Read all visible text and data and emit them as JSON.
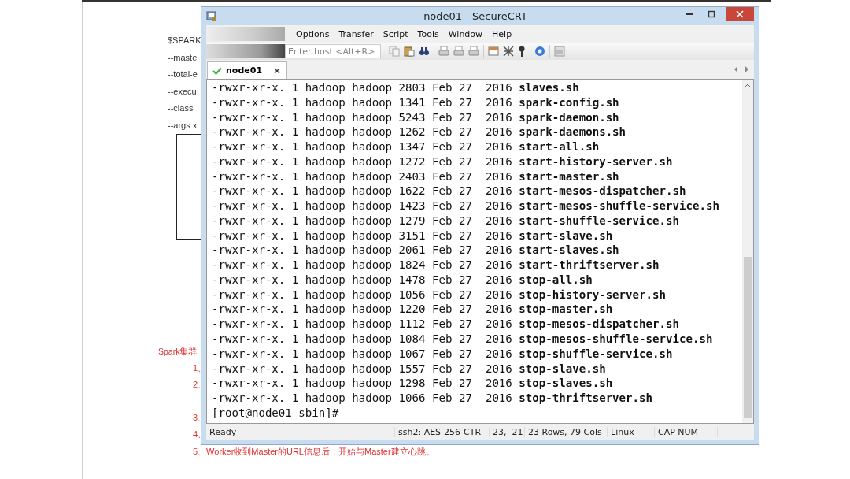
{
  "document": {
    "code_lines": [
      "$SPARK",
      "--maste",
      "--total-e",
      "--execu",
      "--class",
      "--args x"
    ],
    "heading": "Spark集群",
    "steps": [
      "1、",
      "2、",
      "3、",
      "4、",
      "5、Worker收到Master的URL信息后，开始与Master建立心跳。"
    ]
  },
  "window": {
    "title": "node01 - SecureCRT"
  },
  "menu": [
    "Options",
    "Transfer",
    "Script",
    "Tools",
    "Window",
    "Help"
  ],
  "toolbar": {
    "host_field": {
      "placeholder": "Enter host <Alt+R>"
    }
  },
  "tabs": [
    {
      "label": "node01",
      "selected": true,
      "connected": true
    }
  ],
  "terminal": {
    "rows": [
      {
        "meta": "-rwxr-xr-x. 1 hadoop hadoop 2803 Feb 27  2016",
        "name": "slaves.sh"
      },
      {
        "meta": "-rwxr-xr-x. 1 hadoop hadoop 1341 Feb 27  2016",
        "name": "spark-config.sh"
      },
      {
        "meta": "-rwxr-xr-x. 1 hadoop hadoop 5243 Feb 27  2016",
        "name": "spark-daemon.sh"
      },
      {
        "meta": "-rwxr-xr-x. 1 hadoop hadoop 1262 Feb 27  2016",
        "name": "spark-daemons.sh"
      },
      {
        "meta": "-rwxr-xr-x. 1 hadoop hadoop 1347 Feb 27  2016",
        "name": "start-all.sh"
      },
      {
        "meta": "-rwxr-xr-x. 1 hadoop hadoop 1272 Feb 27  2016",
        "name": "start-history-server.sh"
      },
      {
        "meta": "-rwxr-xr-x. 1 hadoop hadoop 2403 Feb 27  2016",
        "name": "start-master.sh"
      },
      {
        "meta": "-rwxr-xr-x. 1 hadoop hadoop 1622 Feb 27  2016",
        "name": "start-mesos-dispatcher.sh"
      },
      {
        "meta": "-rwxr-xr-x. 1 hadoop hadoop 1423 Feb 27  2016",
        "name": "start-mesos-shuffle-service.sh"
      },
      {
        "meta": "-rwxr-xr-x. 1 hadoop hadoop 1279 Feb 27  2016",
        "name": "start-shuffle-service.sh"
      },
      {
        "meta": "-rwxr-xr-x. 1 hadoop hadoop 3151 Feb 27  2016",
        "name": "start-slave.sh"
      },
      {
        "meta": "-rwxr-xr-x. 1 hadoop hadoop 2061 Feb 27  2016",
        "name": "start-slaves.sh"
      },
      {
        "meta": "-rwxr-xr-x. 1 hadoop hadoop 1824 Feb 27  2016",
        "name": "start-thriftserver.sh"
      },
      {
        "meta": "-rwxr-xr-x. 1 hadoop hadoop 1478 Feb 27  2016",
        "name": "stop-all.sh"
      },
      {
        "meta": "-rwxr-xr-x. 1 hadoop hadoop 1056 Feb 27  2016",
        "name": "stop-history-server.sh"
      },
      {
        "meta": "-rwxr-xr-x. 1 hadoop hadoop 1220 Feb 27  2016",
        "name": "stop-master.sh"
      },
      {
        "meta": "-rwxr-xr-x. 1 hadoop hadoop 1112 Feb 27  2016",
        "name": "stop-mesos-dispatcher.sh"
      },
      {
        "meta": "-rwxr-xr-x. 1 hadoop hadoop 1084 Feb 27  2016",
        "name": "stop-mesos-shuffle-service.sh"
      },
      {
        "meta": "-rwxr-xr-x. 1 hadoop hadoop 1067 Feb 27  2016",
        "name": "stop-shuffle-service.sh"
      },
      {
        "meta": "-rwxr-xr-x. 1 hadoop hadoop 1557 Feb 27  2016",
        "name": "stop-slave.sh"
      },
      {
        "meta": "-rwxr-xr-x. 1 hadoop hadoop 1298 Feb 27  2016",
        "name": "stop-slaves.sh"
      },
      {
        "meta": "-rwxr-xr-x. 1 hadoop hadoop 1066 Feb 27  2016",
        "name": "stop-thriftserver.sh"
      }
    ],
    "prompt": "[root@node01 sbin]#"
  },
  "status_bar": [
    "Ready",
    "ssh2: AES-256-CTR",
    "23,  21",
    "23 Rows, 79 Cols",
    "Linux",
    "CAP NUM"
  ]
}
